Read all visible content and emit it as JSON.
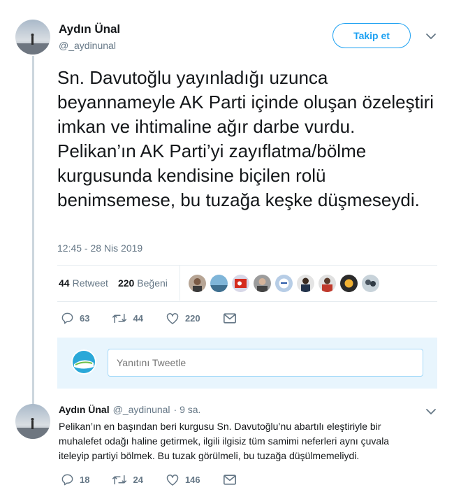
{
  "main_tweet": {
    "author_name": "Aydın Ünal",
    "author_handle": "@_aydinunal",
    "follow_label": "Takip et",
    "text": "Sn. Davutoğlu yayınladığı uzunca beyannameyle AK Parti içinde oluşan özeleştiri imkan ve ihtimaline ağır darbe vurdu. Pelikan’ın AK Parti’yi zayıflatma/bölme kurgusunda kendisine biçilen rolü benimsemese, bu tuzağa keşke düşmeseydi.",
    "timestamp": "12:45 - 28 Nis 2019",
    "retweet_count": "44",
    "retweet_label": "Retweet",
    "like_count": "220",
    "like_label": "Beğeni",
    "actions": {
      "replies": "63",
      "retweets": "44",
      "likes": "220"
    }
  },
  "reply_box": {
    "placeholder": "Yanıtını Tweetle"
  },
  "reply_tweet": {
    "author_name": "Aydın Ünal",
    "author_handle": "@_aydinunal",
    "time": "· 9 sa.",
    "text": "Pelikan’ın en başından beri kurgusu Sn. Davutoğlu’nu abartılı eleştiriyle bir muhalefet odağı haline getirmek, ilgili ilgisiz tüm samimi neferleri aynı çuvala iteleyip partiyi bölmek. Bu tuzak görülmeli, bu tuzağa düşülmemeliydi.",
    "actions": {
      "replies": "18",
      "retweets": "24",
      "likes": "146"
    }
  },
  "colors": {
    "accent": "#1da1f2",
    "muted": "#657786",
    "text": "#14171a",
    "border": "#e6ecf0"
  },
  "icons": [
    "chevron-down-icon",
    "reply-icon",
    "retweet-icon",
    "like-icon",
    "direct-message-icon"
  ]
}
